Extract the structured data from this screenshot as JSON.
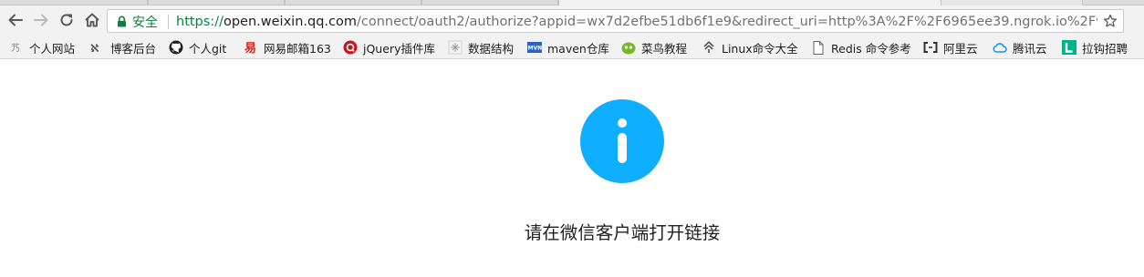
{
  "toolbar": {
    "back": "back",
    "forward": "forward",
    "reload": "reload",
    "home": "home"
  },
  "omnibox": {
    "security_label": "安全",
    "url_scheme": "https://",
    "url_host": "open.weixin.qq.com",
    "url_path": "/connect/oauth2/authorize?appid=wx7d2efbe51db6f1e9&redirect_uri=http%3A%2F%2F6965ee39.ngrok.io%2Fweixin%2..."
  },
  "bookmarks": [
    {
      "label": "个人网站",
      "icon": "site-icon"
    },
    {
      "label": "博客后台",
      "icon": "blog-icon"
    },
    {
      "label": "个人git",
      "icon": "github-icon"
    },
    {
      "label": "网易邮箱163",
      "icon": "netease-icon"
    },
    {
      "label": "jQuery插件库",
      "icon": "jquery-icon"
    },
    {
      "label": "数据结构",
      "icon": "datastructure-icon"
    },
    {
      "label": "maven仓库",
      "icon": "maven-icon"
    },
    {
      "label": "菜鸟教程",
      "icon": "runoob-icon"
    },
    {
      "label": "Linux命令大全",
      "icon": "linux-icon"
    },
    {
      "label": "Redis 命令参考",
      "icon": "page-icon"
    },
    {
      "label": "阿里云",
      "icon": "aliyun-icon"
    },
    {
      "label": "腾讯云",
      "icon": "tencentcloud-icon"
    },
    {
      "label": "拉钩招聘",
      "icon": "lagou-icon"
    }
  ],
  "content": {
    "message": "请在微信客户端打开链接"
  },
  "colors": {
    "info_blue": "#10aeff",
    "secure_green": "#0b8043"
  }
}
